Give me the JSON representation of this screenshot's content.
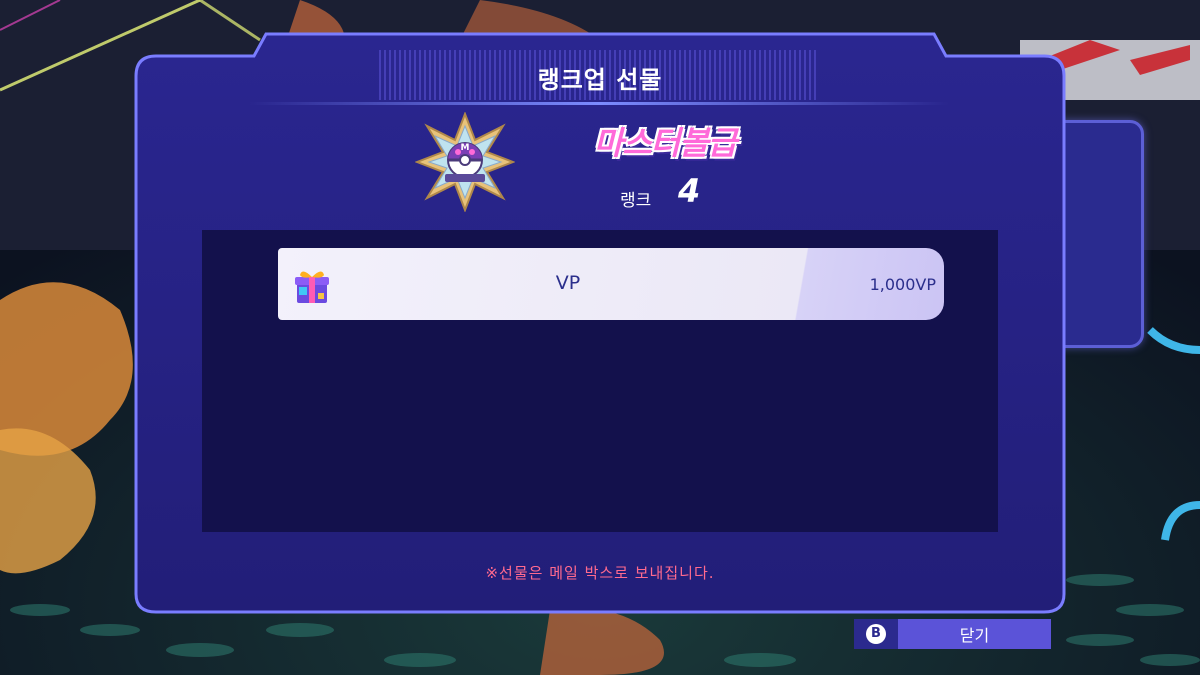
{
  "dialog": {
    "title": "랭크업 선물",
    "rank_tier": "마스터볼급",
    "rank_label": "랭크",
    "rank_number": "4",
    "emblem_icon": "master-ball-star-emblem-icon",
    "note": "※선물은 메일 박스로 보내집니다."
  },
  "rewards": [
    {
      "icon": "gift-box-icon",
      "name": "VP",
      "amount": "1,000VP"
    }
  ],
  "close_button": {
    "key": "B",
    "label": "닫기"
  },
  "colors": {
    "modal_bg": "#24207a",
    "modal_border": "#6a6dff",
    "reward_area_bg": "#13114c",
    "reward_text": "#2b2f8c",
    "note_text": "#ff6a8e",
    "rank_tier_text": "#ff6ad9",
    "button_bg": "#5b53d8"
  }
}
